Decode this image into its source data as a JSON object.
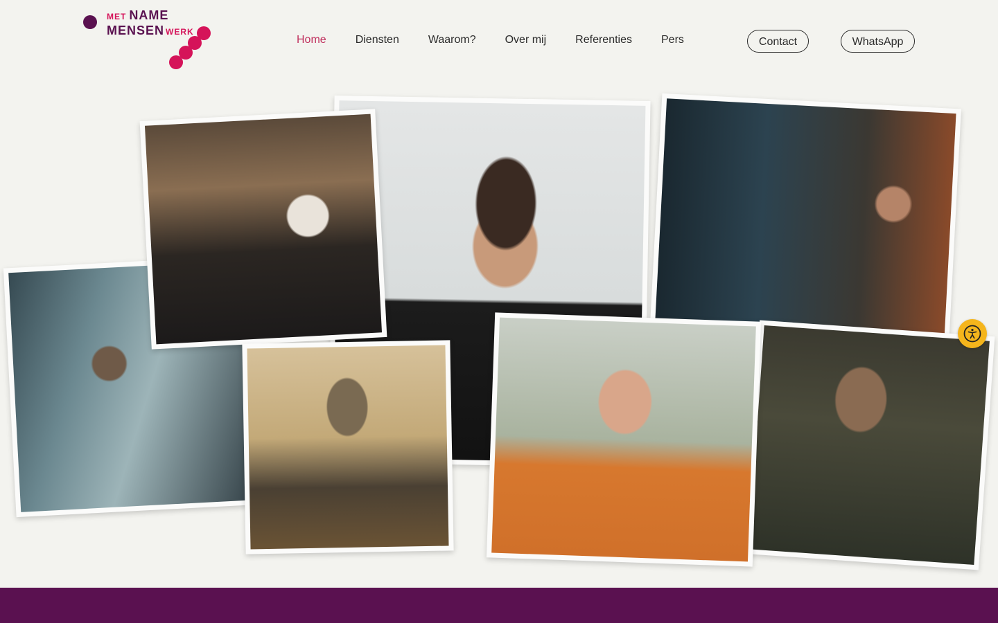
{
  "brand": {
    "line1_small": "MET",
    "line1_big": "NAME",
    "line2_big": "MENSEN",
    "line2_small": "WERK",
    "colors": {
      "primary": "#5a1150",
      "accent": "#d51359"
    }
  },
  "nav": {
    "items": [
      {
        "label": "Home",
        "active": true
      },
      {
        "label": "Diensten"
      },
      {
        "label": "Waarom?"
      },
      {
        "label": "Over mij"
      },
      {
        "label": "Referenties"
      },
      {
        "label": "Pers"
      }
    ],
    "active_color": "#c0305e"
  },
  "buttons": {
    "contact": "Contact",
    "whatsapp": "WhatsApp"
  },
  "accessibility": {
    "icon": "accessibility-icon",
    "color": "#f5b51c"
  },
  "footer_band": {
    "color": "#5a1150"
  }
}
